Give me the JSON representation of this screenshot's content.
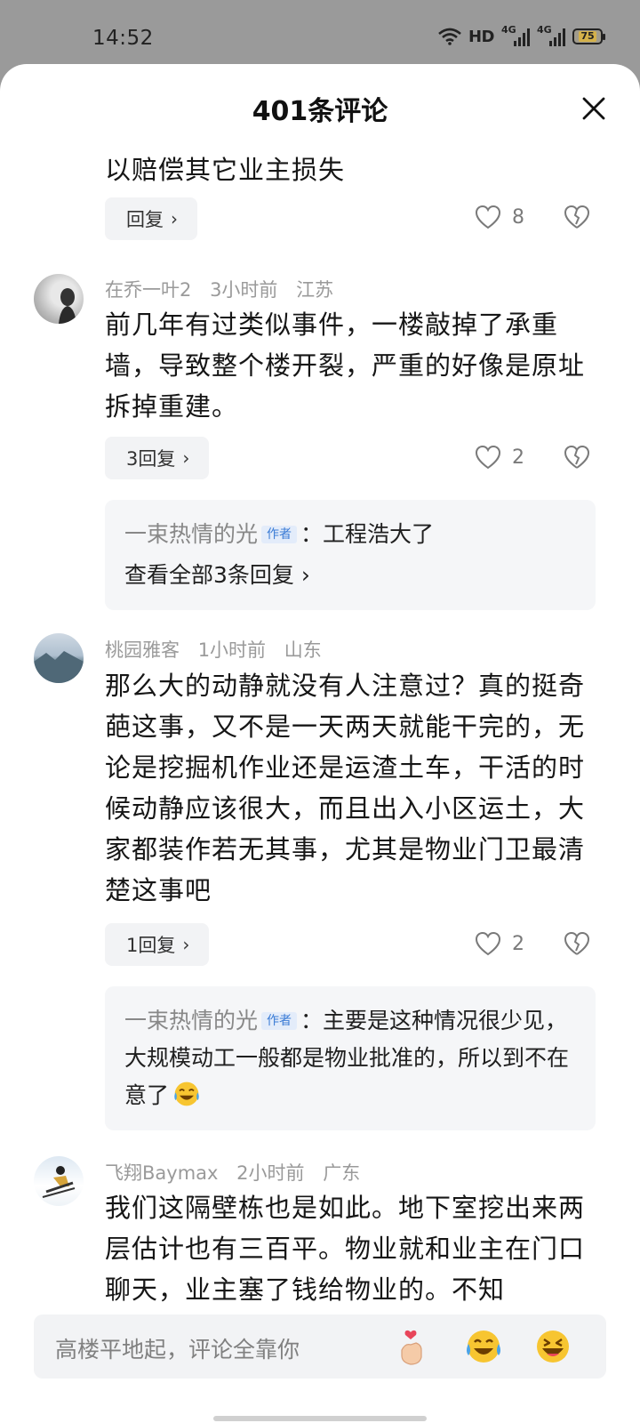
{
  "status_bar": {
    "time": "14:52",
    "network_label": "HD",
    "signal1_label": "4G",
    "signal2_label": "4G",
    "battery_level": "75"
  },
  "header": {
    "title": "401条评论",
    "close_icon": "close-icon"
  },
  "comments": [
    {
      "text": "以赔偿其它业主损失",
      "reply_button": "回复",
      "likes": "8"
    },
    {
      "user": "在乔一叶2",
      "time": "3小时前",
      "location": "江苏",
      "text": "前几年有过类似事件，一楼敲掉了承重墙，导致整个楼开裂，严重的好像是原址拆掉重建。",
      "reply_button": "3回复",
      "likes": "2",
      "sub_reply": {
        "user": "一束热情的光",
        "tag": "作者",
        "text": "：工程浩大了",
        "view_all": "查看全部3条回复"
      }
    },
    {
      "user": "桃园雅客",
      "time": "1小时前",
      "location": "山东",
      "text": "那么大的动静就没有人注意过？真的挺奇葩这事，又不是一天两天就能干完的，无论是挖掘机作业还是运渣土车，干活的时候动静应该很大，而且出入小区运土，大家都装作若无其事，尤其是物业门卫最清楚这事吧",
      "reply_button": "1回复",
      "likes": "2",
      "sub_reply": {
        "user": "一束热情的光",
        "tag": "作者",
        "text": "：主要是这种情况很少见，大规模动工一般都是物业批准的，所以到不在意了"
      }
    },
    {
      "user": "飞翔Baymax",
      "time": "2小时前",
      "location": "广东",
      "text": "我们这隔壁栋也是如此。地下室挖出来两层估计也有三百平。物业就和业主在门口聊天，业主塞了钱给物业的。不知"
    }
  ],
  "input": {
    "placeholder": "高楼平地起，评论全靠你"
  },
  "colors": {
    "accent_tag": "#3a7bd5",
    "meta_gray": "#9a9a9a",
    "reply_bg": "#f2f3f5"
  }
}
